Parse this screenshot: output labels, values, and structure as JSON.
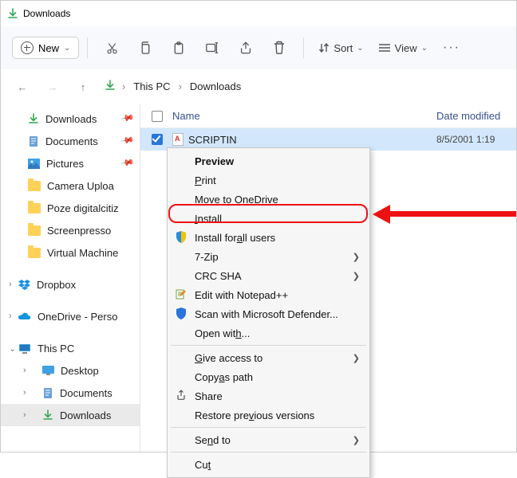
{
  "titlebar": {
    "title": "Downloads"
  },
  "toolbar": {
    "new_label": "New",
    "sort_label": "Sort",
    "view_label": "View"
  },
  "breadcrumbs": {
    "a": "This PC",
    "b": "Downloads"
  },
  "sidebar": {
    "items": [
      {
        "label": "Downloads"
      },
      {
        "label": "Documents"
      },
      {
        "label": "Pictures"
      },
      {
        "label": "Camera Uploa"
      },
      {
        "label": "Poze digitalcitiz"
      },
      {
        "label": "Screenpresso"
      },
      {
        "label": "Virtual Machine"
      },
      {
        "label": "Dropbox"
      },
      {
        "label": "OneDrive - Perso"
      },
      {
        "label": "This PC"
      },
      {
        "label": "Desktop"
      },
      {
        "label": "Documents"
      },
      {
        "label": "Downloads"
      }
    ]
  },
  "columns": {
    "name": "Name",
    "date": "Date modified"
  },
  "file": {
    "name": "SCRIPTIN",
    "date": "8/5/2001 1:19"
  },
  "menu": {
    "preview": "Preview",
    "print": "Print",
    "move_od": "Move to OneDrive",
    "install": "Install",
    "install_all": "Install for all users",
    "sevenzip": "7-Zip",
    "crc": "CRC SHA",
    "notepad": "Edit with Notepad++",
    "defender": "Scan with Microsoft Defender...",
    "openwith": "Open with...",
    "giveaccess": "Give access to",
    "copypath": "Copy as path",
    "share": "Share",
    "restore": "Restore previous versions",
    "sendto": "Send to",
    "cut": "Cut"
  }
}
